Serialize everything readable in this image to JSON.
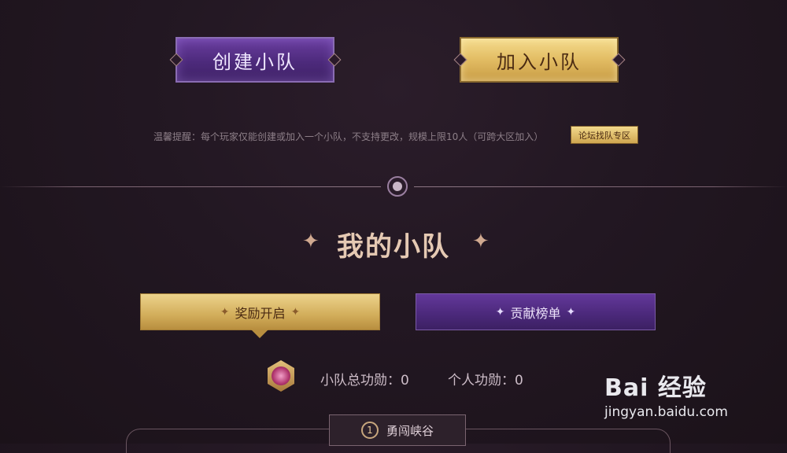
{
  "top_buttons": {
    "create": "创建小队",
    "join": "加入小队"
  },
  "notice": {
    "text": "温馨提醒：每个玩家仅能创建或加入一个小队，不支持更改，规模上限10人（可跨大区加入）",
    "forum_button": "论坛找队专区"
  },
  "section": {
    "title": "我的小队",
    "star_glyph": "✦"
  },
  "tabs": {
    "reward": "奖励开启",
    "contribution": "贡献榜单",
    "spark_glyph": "✦"
  },
  "merit": {
    "team_total": "小队总功勋：0",
    "personal": "个人功勋：0"
  },
  "bottom_tab": {
    "number": "1",
    "label": "勇闯峡谷"
  },
  "watermark": {
    "logo": "Bai 经验",
    "url": "jingyan.baidu.com"
  },
  "colors": {
    "gold": "#e2bc63",
    "purple": "#4d2a7c",
    "background": "#221722",
    "title": "#e5c9b3"
  },
  "icons": {
    "medallion": "divider-medallion-icon",
    "badge": "team-badge-icon",
    "paw": "baidu-paw-icon"
  }
}
